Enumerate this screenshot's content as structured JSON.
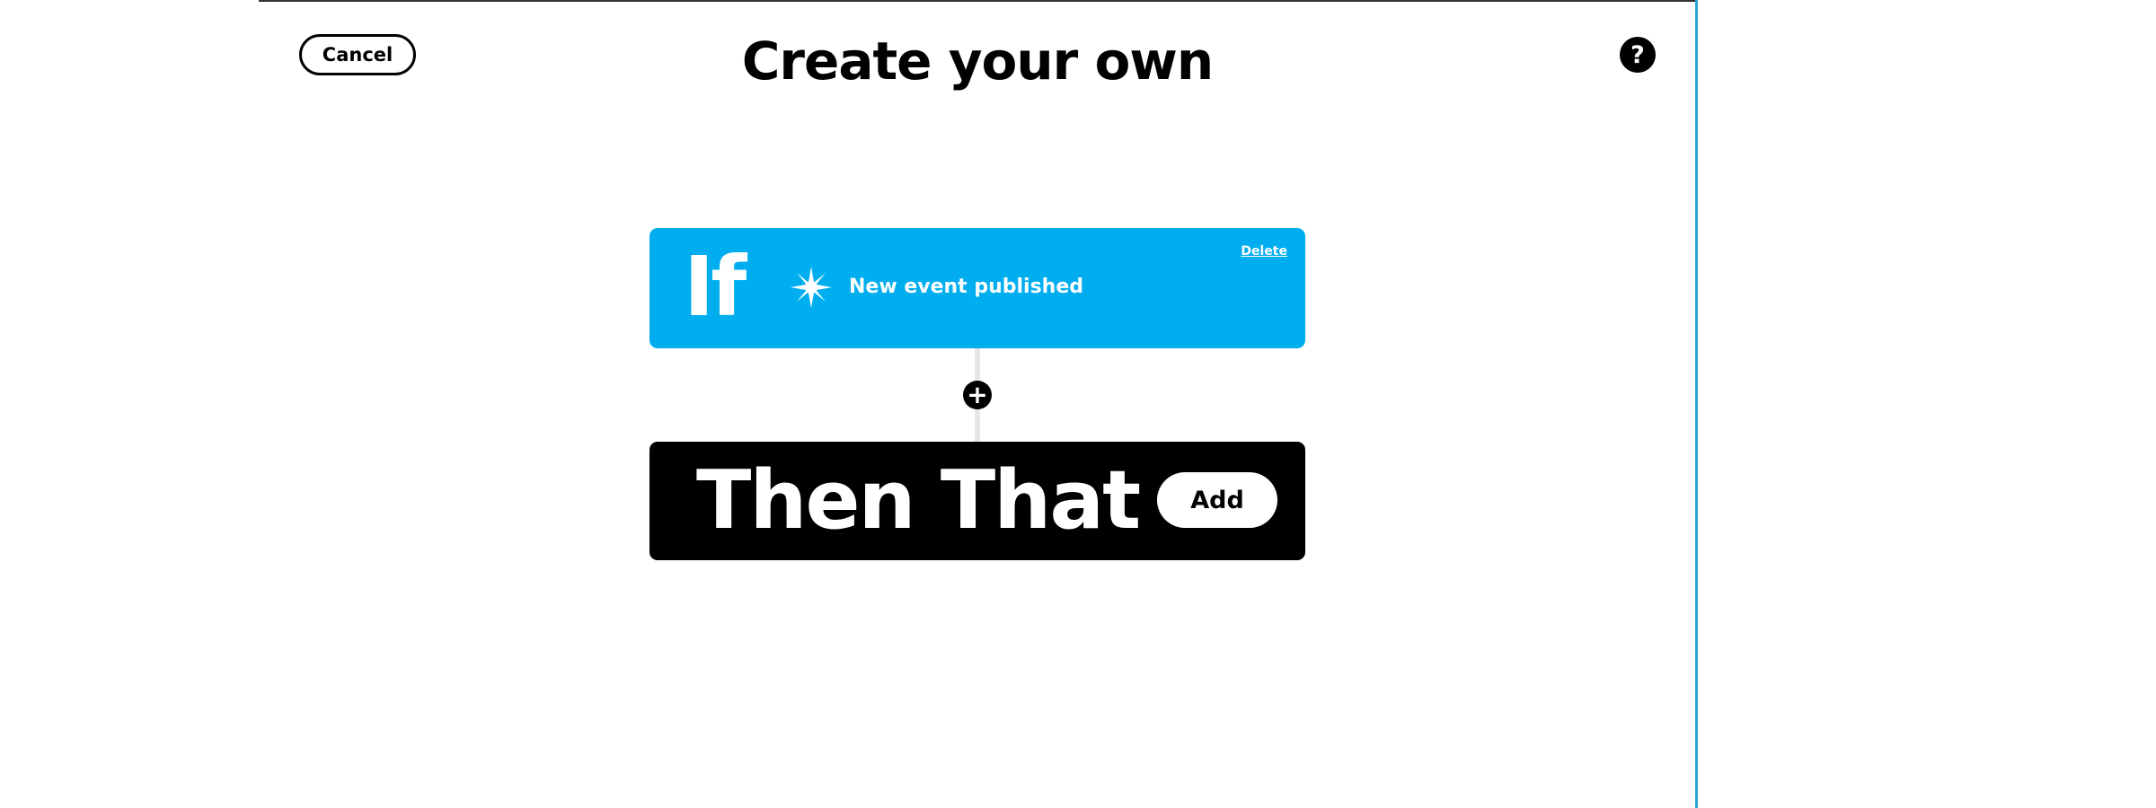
{
  "header": {
    "cancel_label": "Cancel",
    "title": "Create your own",
    "help_icon": "question-circle-icon",
    "help_glyph": "?"
  },
  "if_card": {
    "keyword": "If",
    "trigger_icon": "sparkle-burst-icon",
    "trigger_label": "New event published",
    "delete_label": "Delete",
    "color": "#00aeef"
  },
  "add_step": {
    "icon": "plus-circle-icon",
    "glyph": "+"
  },
  "then_card": {
    "keyword": "Then That",
    "add_label": "Add",
    "color": "#000000"
  },
  "colors": {
    "accent": "#00aeef",
    "window_edge": "#2aa5d8",
    "text": "#000000",
    "background": "#ffffff"
  }
}
